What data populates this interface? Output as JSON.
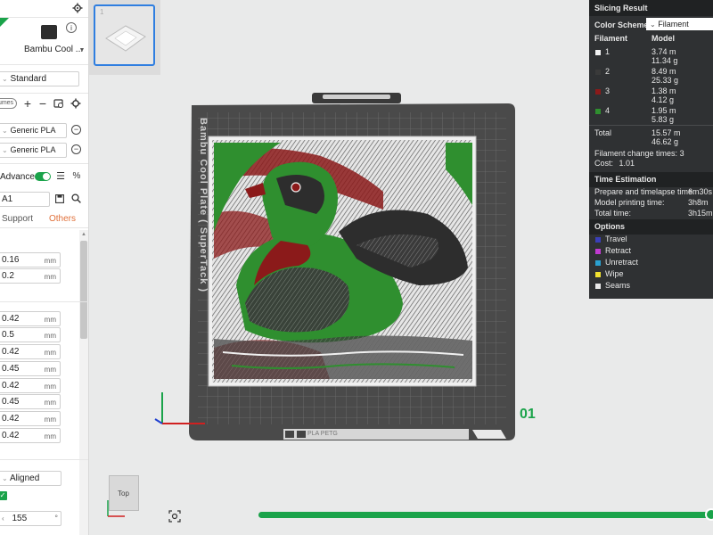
{
  "left_panel": {
    "printer_name": "Bambu Cool ...",
    "preset_standard": "Standard",
    "volumes_label": "umes",
    "filament_1": "Generic PLA",
    "filament_2": "Generic PLA",
    "advanced_label": "Advanced",
    "profile_name": "A1",
    "tab_support": "Support",
    "tab_others": "Others",
    "values": [
      "0.16",
      "0.2",
      "0.42",
      "0.5",
      "0.42",
      "0.45",
      "0.42",
      "0.45",
      "0.42",
      "0.42"
    ],
    "unit": "mm",
    "seam_value": "Aligned",
    "angle_value": "155"
  },
  "thumbnail": {
    "label": "1"
  },
  "bed": {
    "plate_text": "Bambu Cool Plate ( SuperTack )",
    "plate_number": "01",
    "bottom_tag": "PLA PETG"
  },
  "nav_cube": {
    "label": "Top"
  },
  "progress": {
    "fraction": 1.0
  },
  "slicing_result": {
    "title": "Slicing Result",
    "color_scheme_label": "Color Scheme",
    "color_scheme_value": "Filament",
    "col_filament": "Filament",
    "col_model": "Model",
    "filaments": [
      {
        "id": "1",
        "length": "3.74 m",
        "weight": "11.34 g",
        "color": "#f2f2f2"
      },
      {
        "id": "2",
        "length": "8.49 m",
        "weight": "25.33 g",
        "color": "#3a3a3a"
      },
      {
        "id": "3",
        "length": "1.38 m",
        "weight": "4.12 g",
        "color": "#8b1a1a"
      },
      {
        "id": "4",
        "length": "1.95 m",
        "weight": "5.83 g",
        "color": "#2f8f2f"
      }
    ],
    "total_label": "Total",
    "total_length": "15.57 m",
    "total_weight": "46.62 g",
    "change_times_label": "Filament change times:",
    "change_times": "3",
    "cost_label": "Cost:",
    "cost": "1.01",
    "time_title": "Time Estimation",
    "prepare_label": "Prepare and timelapse time:",
    "prepare_value": "6m30s",
    "model_time_label": "Model printing time:",
    "model_time_value": "3h8m",
    "total_time_label": "Total time:",
    "total_time_value": "3h15m",
    "options_title": "Options",
    "options": [
      {
        "label": "Travel",
        "color": "#3a3fb8"
      },
      {
        "label": "Retract",
        "color": "#c03ad0"
      },
      {
        "label": "Unretract",
        "color": "#2aa0d0"
      },
      {
        "label": "Wipe",
        "color": "#f0e030"
      },
      {
        "label": "Seams",
        "color": "#e8e8e8"
      }
    ]
  }
}
